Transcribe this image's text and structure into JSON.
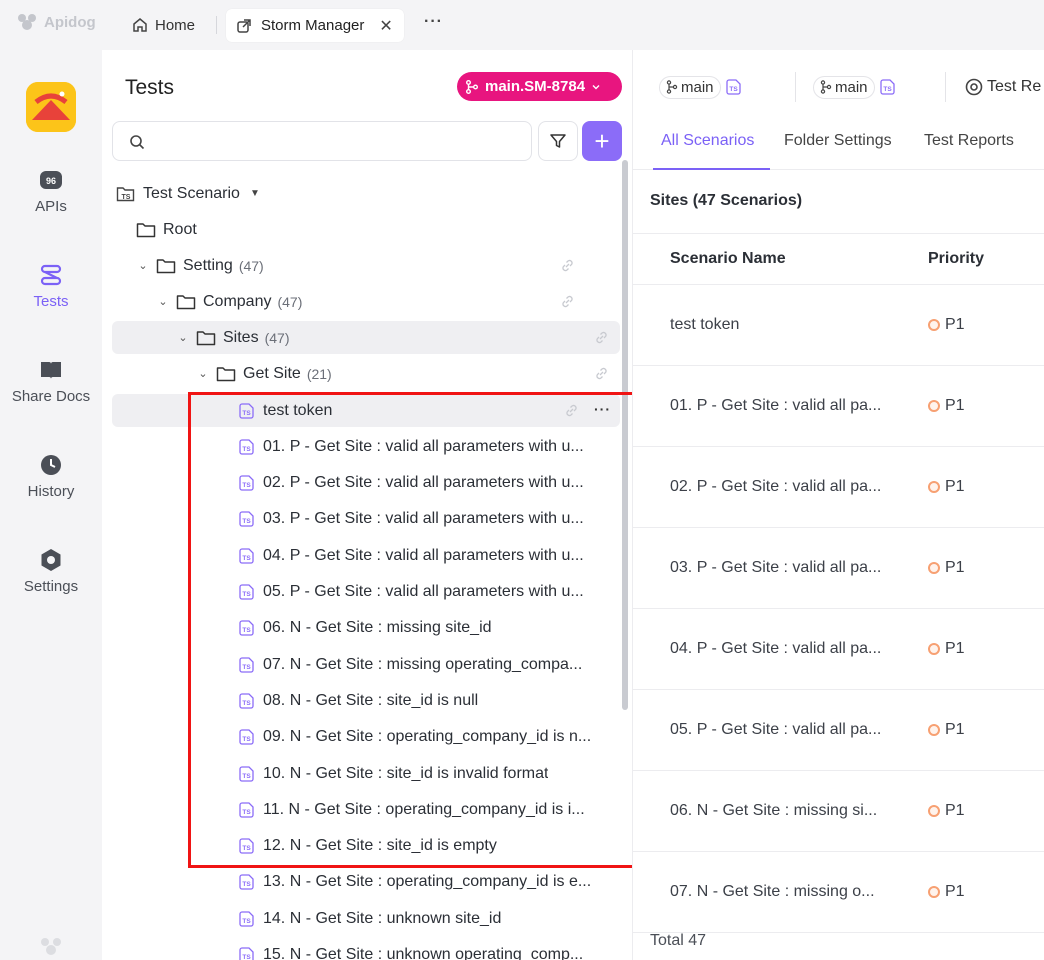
{
  "topbar": {
    "brand": "Apidog",
    "home_tab": "Home",
    "active_tab": "Storm Manager",
    "close_glyph": "✕",
    "more_glyph": "···"
  },
  "rail": {
    "items": [
      {
        "label": "APIs",
        "icon": "api-icon"
      },
      {
        "label": "Tests",
        "icon": "tests-icon",
        "active": true
      },
      {
        "label": "Share Docs",
        "icon": "book-icon"
      },
      {
        "label": "History",
        "icon": "history-icon"
      },
      {
        "label": "Settings",
        "icon": "settings-icon"
      }
    ]
  },
  "tree": {
    "title": "Tests",
    "branch": "main.SM-8784",
    "add_glyph": "+",
    "root_label": "Test Scenario",
    "nodes": {
      "root": {
        "label": "Root"
      },
      "setting": {
        "label": "Setting",
        "count": "(47)"
      },
      "company": {
        "label": "Company",
        "count": "(47)"
      },
      "sites": {
        "label": "Sites",
        "count": "(47)"
      },
      "get_site": {
        "label": "Get Site",
        "count": "(21)"
      }
    },
    "scenarios": [
      "test token",
      "01. P - Get Site : valid all parameters with u...",
      "02. P - Get Site : valid all parameters with u...",
      "03. P - Get Site : valid all parameters with u...",
      "04. P - Get Site : valid all parameters with u...",
      "05. P - Get Site : valid all parameters with u...",
      "06. N - Get Site : missing site_id",
      "07. N - Get Site : missing operating_compa...",
      "08. N - Get Site : site_id is null",
      "09. N - Get Site : operating_company_id is n...",
      "10. N - Get Site : site_id is invalid format",
      "11. N - Get Site : operating_company_id is i...",
      "12. N - Get Site : site_id is empty",
      "13. N - Get Site : operating_company_id is e...",
      "14. N - Get Site : unknown site_id",
      "15. N - Get Site : unknown operating_comp..."
    ]
  },
  "right": {
    "chips": [
      {
        "label": "main"
      },
      {
        "label": "main"
      }
    ],
    "test_reports_chip": "Test Re",
    "tabs": [
      "All Scenarios",
      "Folder Settings",
      "Test Reports"
    ],
    "heading": "Sites (47 Scenarios)",
    "columns": [
      "Scenario Name",
      "Priority"
    ],
    "rows": [
      {
        "name": "test token",
        "priority": "P1"
      },
      {
        "name": "01. P - Get Site : valid all pa...",
        "priority": "P1"
      },
      {
        "name": "02. P - Get Site : valid all pa...",
        "priority": "P1"
      },
      {
        "name": "03. P - Get Site : valid all pa...",
        "priority": "P1"
      },
      {
        "name": "04. P - Get Site : valid all pa...",
        "priority": "P1"
      },
      {
        "name": "05. P - Get Site : valid all pa...",
        "priority": "P1"
      },
      {
        "name": "06. N - Get Site : missing si...",
        "priority": "P1"
      },
      {
        "name": "07. N - Get Site : missing o...",
        "priority": "P1"
      }
    ],
    "total": "Total 47"
  },
  "colors": {
    "accent": "#7b61f6",
    "branch_badge": "#e8157f",
    "highlight_box": "#f01414",
    "priority_dot": "#f7a072"
  }
}
